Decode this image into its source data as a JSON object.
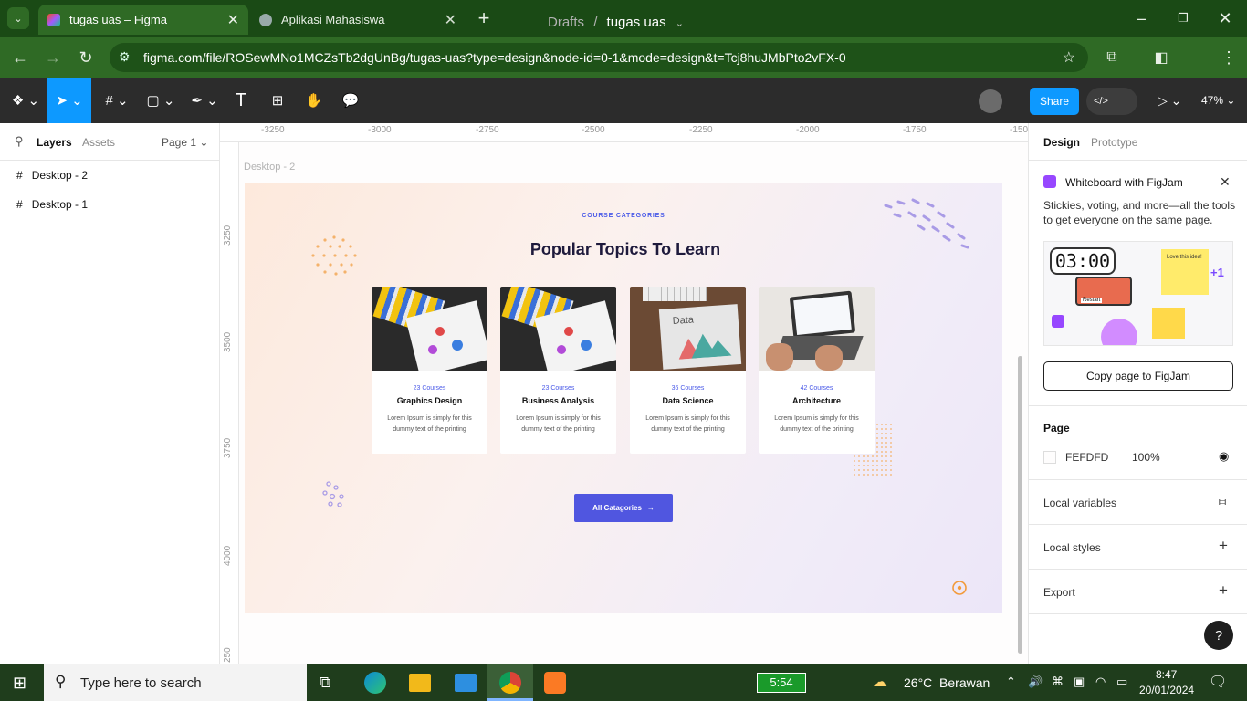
{
  "browser": {
    "tabs": [
      {
        "title": "tugas uas – Figma",
        "close": "✕"
      },
      {
        "title": "Aplikasi Mahasiswa",
        "close": "✕"
      }
    ],
    "new_tab": "+",
    "url": "figma.com/file/ROSewMNo1MCZsTb2dgUnBg/tugas-uas?type=design&node-id=0-1&mode=design&t=Tcj8huJMbPto2vFX-0"
  },
  "figma": {
    "breadcrumb": {
      "parent": "Drafts",
      "sep": "/",
      "file": "tugas uas"
    },
    "share_label": "Share",
    "zoom": "47%",
    "left_panel": {
      "tab_layers": "Layers",
      "tab_assets": "Assets",
      "page_select": "Page 1",
      "layers": [
        "Desktop - 2",
        "Desktop - 1"
      ]
    },
    "ruler_h": [
      "-3250",
      "-3000",
      "-2750",
      "-2500",
      "-2250",
      "-2000",
      "-1750",
      "-150"
    ],
    "ruler_v": [
      "3250",
      "3500",
      "3750",
      "4000",
      "250"
    ],
    "frame_label": "Desktop - 2",
    "design": {
      "eyebrow": "COURSE CATEGORIES",
      "heading": "Popular Topics To Learn",
      "cards": [
        {
          "count": "23 Courses",
          "name": "Graphics Design",
          "desc": "Lorem Ipsum is simply for this dummy text of the printing"
        },
        {
          "count": "23 Courses",
          "name": "Business Analysis",
          "desc": "Lorem Ipsum is simply for this dummy text of the printing"
        },
        {
          "count": "36 Courses",
          "name": "Data Science",
          "desc": "Lorem Ipsum is simply for this dummy text of the printing"
        },
        {
          "count": "42 Courses",
          "name": "Architecture",
          "desc": "Lorem Ipsum is simply for this dummy text of the printing"
        }
      ],
      "card3_img_text": "Data",
      "cta": "All Catagories",
      "cta_arrow": "→"
    },
    "right_panel": {
      "tab_design": "Design",
      "tab_prototype": "Prototype",
      "promo_title": "Whiteboard with FigJam",
      "promo_text": "Stickies, voting, and more—all the tools to get everyone on the same page.",
      "promo_timer": "03:00",
      "promo_sticky": "Love this idea!",
      "promo_plus": "+1",
      "promo_restart": "Restart",
      "promo_button": "Copy page to FigJam",
      "page_title": "Page",
      "page_color": "FEFDFD",
      "page_opacity": "100%",
      "local_variables": "Local variables",
      "local_styles": "Local styles",
      "export": "Export",
      "help": "?"
    }
  },
  "taskbar": {
    "search_placeholder": "Type here to search",
    "battery_time": "5:54",
    "weather": "26°C  Berawan",
    "time": "8:47",
    "date": "20/01/2024"
  },
  "colors": {
    "accent": "#0d99ff",
    "chrome": "#2f6a25",
    "cta": "#5056e0",
    "card_count": "#4a5ae8"
  }
}
